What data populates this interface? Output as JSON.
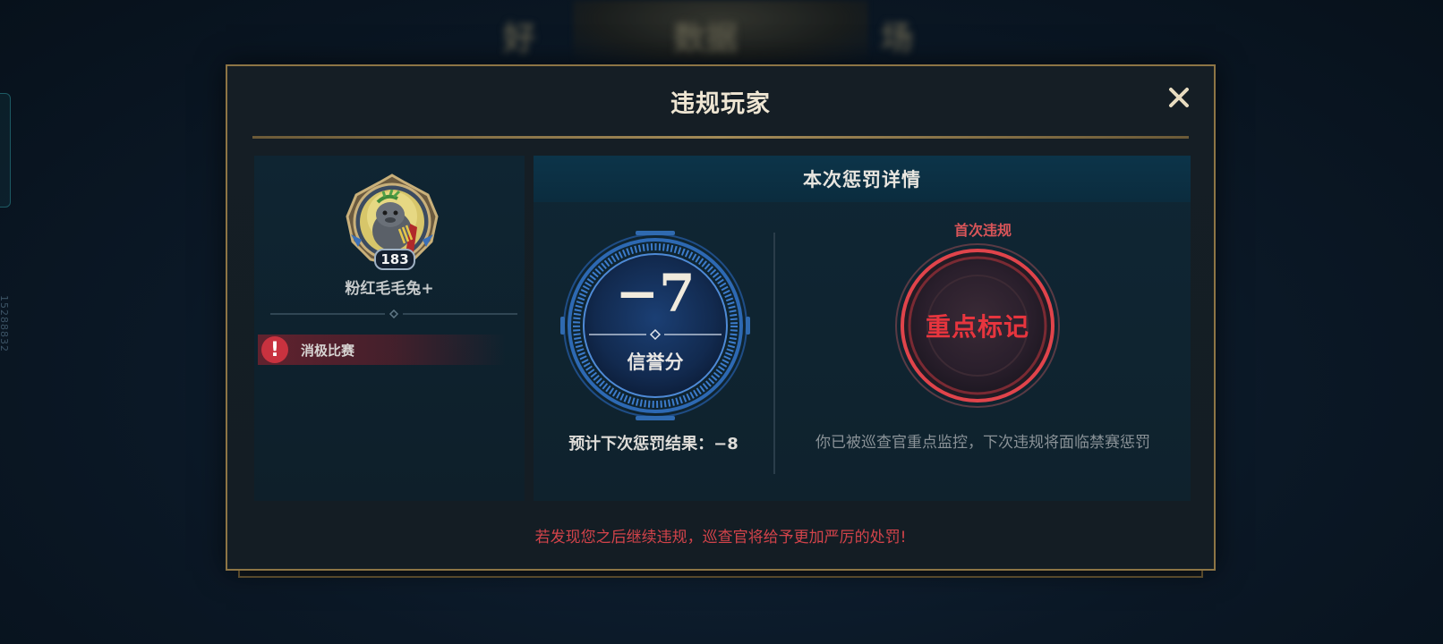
{
  "background": {
    "header_left": "好",
    "header_center": "数据",
    "header_right": "场",
    "side_id": "15288832"
  },
  "dialog": {
    "title": "违规玩家",
    "close_icon": "close-icon"
  },
  "player": {
    "name": "粉红毛毛兔+",
    "level": "183",
    "avatar_icon": "seal-laurel-avatar",
    "violation": {
      "icon": "exclamation-icon",
      "label": "消极比赛"
    }
  },
  "penalty": {
    "header": "本次惩罚详情",
    "score_value": "−7",
    "score_label": "信誉分",
    "next_penalty": "预计下次惩罚结果：−8",
    "first_violation": "首次违规",
    "mark_label": "重点标记",
    "monitor_note": "你已被巡查官重点监控，下次违规将面临禁赛惩罚"
  },
  "warning": "若发现您之后继续违规，巡查官将给予更加严厉的处罚!",
  "colors": {
    "gold_border": "#8d7545",
    "accent_red": "#e7353e",
    "ring_blue": "#3f78c2",
    "warning_red": "#d2434a"
  }
}
